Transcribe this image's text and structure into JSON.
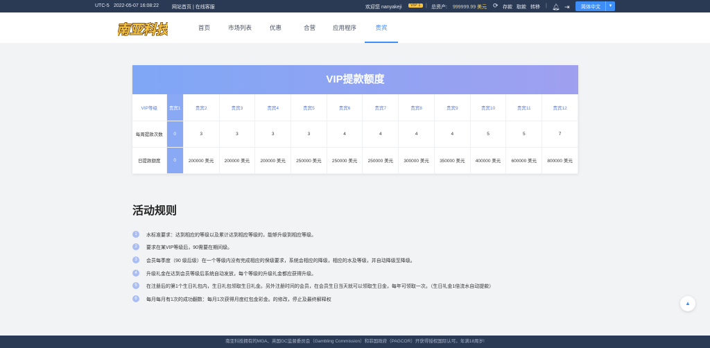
{
  "topbar": {
    "timezone": "UTC-5",
    "datetime": "2022-05-07 16:08:22",
    "links": "网站首页 | 在线客服",
    "welcome": "欢迎您 nanyakeji",
    "vip_badge": "VIP 1",
    "total_label": "总资产:",
    "total_value": "999999.99 美元",
    "deposit": "存款",
    "withdraw": "取款",
    "transfer": "转移",
    "language": "简体中文"
  },
  "nav": {
    "logo_text": "南亚科技",
    "items": [
      {
        "label": "首页"
      },
      {
        "label": "市场列表"
      },
      {
        "label": "优惠"
      },
      {
        "label": "合营"
      },
      {
        "label": "应用程序"
      },
      {
        "label": "贵宾"
      }
    ]
  },
  "vip": {
    "title": "VIP提款额度",
    "row_labels": [
      "VIP等级",
      "每周提款次数",
      "日提款额度"
    ],
    "levels": [
      "贵宾1",
      "贵宾2",
      "贵宾3",
      "贵宾4",
      "贵宾5",
      "贵宾6",
      "贵宾7",
      "贵宾8",
      "贵宾9",
      "贵宾10",
      "贵宾11",
      "贵宾12"
    ],
    "weekly_withdrawals": [
      "0",
      "3",
      "3",
      "3",
      "3",
      "4",
      "4",
      "4",
      "4",
      "5",
      "5",
      "7"
    ],
    "daily_limits": [
      "0",
      "200000 美元",
      "200000 美元",
      "200000 美元",
      "250000 美元",
      "250000 美元",
      "250000 美元",
      "300000 美元",
      "350000 美元",
      "400000 美元",
      "600000 美元",
      "800000 美元"
    ]
  },
  "rules": {
    "title": "活动规则",
    "items": [
      "水标准要求：达到相应的等级以及累计达到相应等级的，能够升级到相应等级。",
      "要求在某VIP等级后，90需要在期间级。",
      "会员每季度（90 级后级）在一个等级内没有完成相应的保级要求，系统会相应的降级，相应的水及等级，并自动降级至降级。",
      "升级礼金在达到会员等级后系统自动发放，每个等级的升级礼金都应获得升级。",
      "在注册后的第1个生日礼包内，生日礼包领取生日礼金。另外注册时间的会员，在会员生日当天就可以领取生日金，每年可领取一次。（生日礼金1倍流水自动提款）",
      "每月每月有1次的成功翻数：每月1次获得月度红包金彩金。的修改，停止及最终解释权"
    ]
  },
  "footer": {
    "text": "南亚科技拥有的MGA、英国GC监督委员会（Gambling Commission）和菲国政府（PAGCOR）开获得授权国际认可。年满18周岁!"
  },
  "colors": {
    "topbar_bg": "#2a3a55",
    "accent": "#3e8ef7",
    "vip_header_start": "#7fa7f6",
    "vip_header_end": "#9fa0ef",
    "vip_highlight": "#8aa9f5",
    "gold": "#ffd24a"
  }
}
